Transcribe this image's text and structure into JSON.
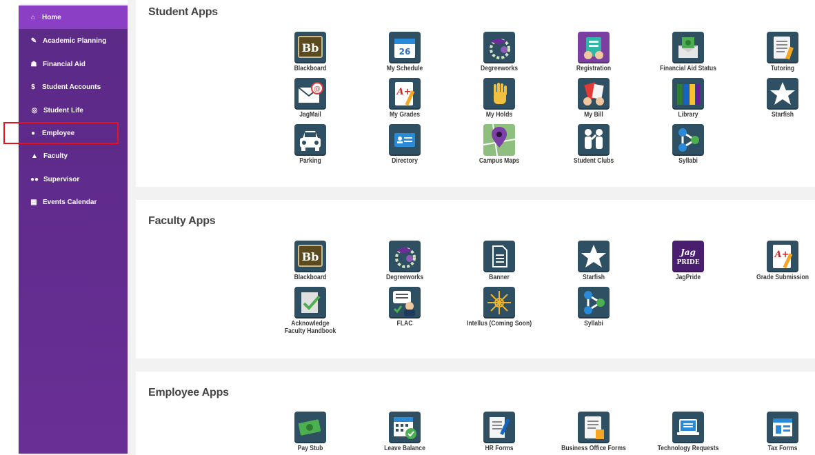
{
  "sidebar": {
    "items": [
      {
        "label": "Home",
        "icon": "home-icon",
        "glyph": "⌂"
      },
      {
        "label": "Academic Planning",
        "icon": "pencil-icon",
        "glyph": "✎"
      },
      {
        "label": "Financial Aid",
        "icon": "piggy-bank-icon",
        "glyph": "☗"
      },
      {
        "label": "Student Accounts",
        "icon": "dollar-icon",
        "glyph": "$"
      },
      {
        "label": "Student Life",
        "icon": "soccer-ball-icon",
        "glyph": "⚽"
      },
      {
        "label": "Employee",
        "icon": "user-icon",
        "glyph": "👤"
      },
      {
        "label": "Faculty",
        "icon": "graduation-cap-icon",
        "glyph": "🎓"
      },
      {
        "label": "Supervisor",
        "icon": "users-icon",
        "glyph": "👥"
      },
      {
        "label": "Events Calendar",
        "icon": "calendar-icon",
        "glyph": "▦"
      }
    ]
  },
  "sections": {
    "student": {
      "title": "Student Apps",
      "apps": [
        "Blackboard",
        "My Schedule",
        "Degreeworks",
        "Registration",
        "Financial Aid Status",
        "Tutoring",
        "JagMail",
        "My Grades",
        "My Holds",
        "My Bill",
        "Library",
        "Starfish",
        "Parking",
        "Directory",
        "Campus Maps",
        "Student Clubs",
        "Syllabi"
      ]
    },
    "faculty": {
      "title": "Faculty Apps",
      "apps": [
        "Blackboard",
        "Degreeworks",
        "Banner",
        "Starfish",
        "JagPride",
        "Grade Submission",
        "Acknowledge Faculty Handbook",
        "FLAC",
        "Intellus (Coming Soon)",
        "Syllabi"
      ]
    },
    "employee": {
      "title": "Employee Apps",
      "apps": [
        "Pay Stub",
        "Leave Balance",
        "HR Forms",
        "Business Office Forms",
        "Technology Requests",
        "Tax Forms"
      ]
    }
  },
  "icon_text": {
    "blackboard": "Bb",
    "schedule_day": "26",
    "jagpride_top": "Jag",
    "jagpride_bottom": "PRIDE",
    "grade": "A+",
    "mail_at": "@"
  },
  "colors": {
    "sidebar": "#5f2b8c",
    "sidebar_active": "#8b3fc4",
    "highlight": "#e8101a",
    "icon_bg": "#2f4f63"
  }
}
